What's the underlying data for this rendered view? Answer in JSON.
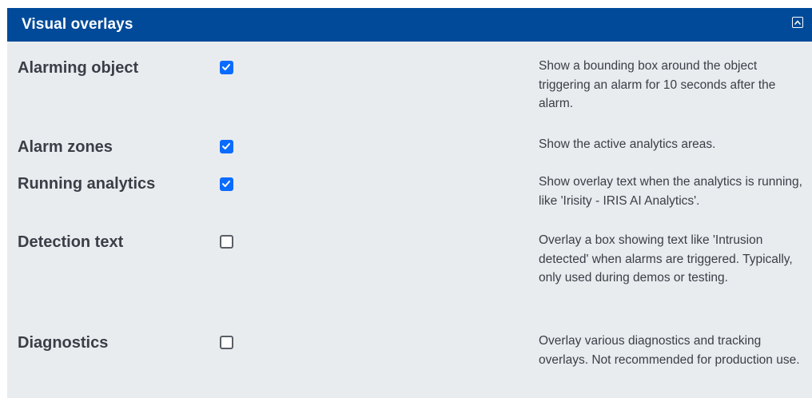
{
  "panel": {
    "title": "Visual overlays",
    "collapse_icon": "chevron-up-square-icon"
  },
  "colors": {
    "header_bg": "#004a99",
    "panel_bg": "#e9ecef",
    "checkbox_checked": "#0a6cff",
    "text": "#3a3f47"
  },
  "options": [
    {
      "label": "Alarming object",
      "checked": true,
      "description": "Show a bounding box around the object triggering an alarm for 10 seconds after the alarm."
    },
    {
      "label": "Alarm zones",
      "checked": true,
      "description": "Show the active analytics areas."
    },
    {
      "label": "Running analytics",
      "checked": true,
      "description": "Show overlay text when the analytics is running, like 'Irisity - IRIS AI Analytics'."
    },
    {
      "label": "Detection text",
      "checked": false,
      "description": "Overlay a box showing text like 'Intrusion detected' when alarms are triggered. Typically, only used during demos or testing."
    },
    {
      "label": "Diagnostics",
      "checked": false,
      "description": "Overlay various diagnostics and tracking overlays. Not recommended for production use."
    }
  ]
}
